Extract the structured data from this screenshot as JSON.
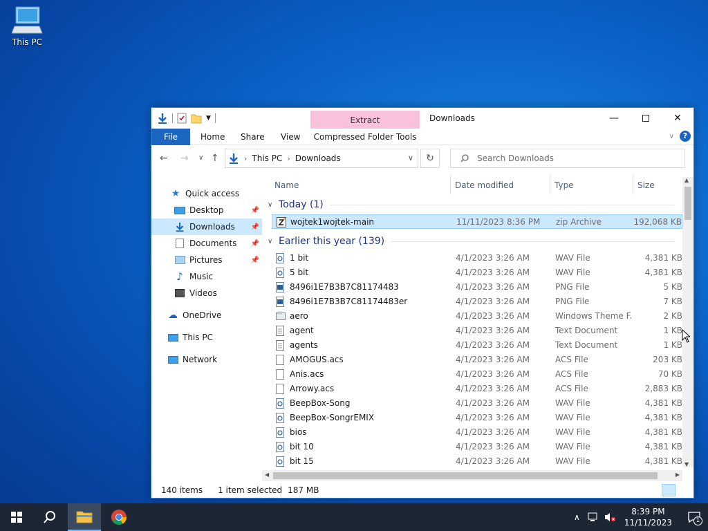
{
  "desktop": {
    "icon_label": "This PC"
  },
  "window": {
    "title": "Downloads",
    "context_tab": "Extract",
    "context_subtab": "Compressed Folder Tools",
    "tabs": {
      "file": "File",
      "home": "Home",
      "share": "Share",
      "view": "View"
    }
  },
  "address": {
    "crumbs": [
      "This PC",
      "Downloads"
    ]
  },
  "search": {
    "placeholder": "Search Downloads"
  },
  "nav": {
    "quick_access": "Quick access",
    "desktop": "Desktop",
    "downloads": "Downloads",
    "documents": "Documents",
    "pictures": "Pictures",
    "music": "Music",
    "videos": "Videos",
    "onedrive": "OneDrive",
    "this_pc": "This PC",
    "network": "Network"
  },
  "columns": {
    "name": "Name",
    "date": "Date modified",
    "type": "Type",
    "size": "Size"
  },
  "groups": {
    "today": "Today (1)",
    "earlier": "Earlier this year (139)"
  },
  "today_files": [
    {
      "name": "wojtek1wojtek-main",
      "date": "11/11/2023 8:36 PM",
      "type": "zip Archive",
      "size": "192,068 KB",
      "icon": "zip-icon"
    }
  ],
  "files": [
    {
      "name": "1 bit",
      "date": "4/1/2023 3:26 AM",
      "type": "WAV File",
      "size": "4,381 KB",
      "icon": "audio-file-icon"
    },
    {
      "name": "5 bit",
      "date": "4/1/2023 3:26 AM",
      "type": "WAV File",
      "size": "4,381 KB",
      "icon": "audio-file-icon"
    },
    {
      "name": "8496i1E7B3B7C81174483",
      "date": "4/1/2023 3:26 AM",
      "type": "PNG File",
      "size": "5 KB",
      "icon": "image-file-icon"
    },
    {
      "name": "8496i1E7B3B7C81174483er",
      "date": "4/1/2023 3:26 AM",
      "type": "PNG File",
      "size": "7 KB",
      "icon": "image-file-icon"
    },
    {
      "name": "aero",
      "date": "4/1/2023 3:26 AM",
      "type": "Windows Theme F...",
      "size": "2 KB",
      "icon": "theme-file-icon"
    },
    {
      "name": "agent",
      "date": "4/1/2023 3:26 AM",
      "type": "Text Document",
      "size": "1 KB",
      "icon": "text-file-icon"
    },
    {
      "name": "agents",
      "date": "4/1/2023 3:26 AM",
      "type": "Text Document",
      "size": "1 KB",
      "icon": "text-file-icon"
    },
    {
      "name": "AMOGUS.acs",
      "date": "4/1/2023 3:26 AM",
      "type": "ACS File",
      "size": "203 KB",
      "icon": "blank-file-icon"
    },
    {
      "name": "Anis.acs",
      "date": "4/1/2023 3:26 AM",
      "type": "ACS File",
      "size": "70 KB",
      "icon": "blank-file-icon"
    },
    {
      "name": "Arrowy.acs",
      "date": "4/1/2023 3:26 AM",
      "type": "ACS File",
      "size": "2,883 KB",
      "icon": "blank-file-icon"
    },
    {
      "name": "BeepBox-Song",
      "date": "4/1/2023 3:26 AM",
      "type": "WAV File",
      "size": "4,381 KB",
      "icon": "audio-file-icon"
    },
    {
      "name": "BeepBox-SongrEMIX",
      "date": "4/1/2023 3:26 AM",
      "type": "WAV File",
      "size": "4,381 KB",
      "icon": "audio-file-icon"
    },
    {
      "name": "bios",
      "date": "4/1/2023 3:26 AM",
      "type": "WAV File",
      "size": "4,381 KB",
      "icon": "audio-file-icon"
    },
    {
      "name": "bit 10",
      "date": "4/1/2023 3:26 AM",
      "type": "WAV File",
      "size": "4,381 KB",
      "icon": "audio-file-icon"
    },
    {
      "name": "bit 15",
      "date": "4/1/2023 3:26 AM",
      "type": "WAV File",
      "size": "4,381 KB",
      "icon": "audio-file-icon"
    }
  ],
  "status": {
    "items": "140 items",
    "selected": "1 item selected",
    "size": "187 MB"
  },
  "clock": {
    "time": "8:39 PM",
    "date": "11/11/2023"
  },
  "notifications": {
    "count": "1"
  },
  "colors": {
    "accent": "#1a66c0",
    "selection": "#cce8ff",
    "group_header": "#1e3287",
    "context_tab": "#f9c1dc"
  }
}
